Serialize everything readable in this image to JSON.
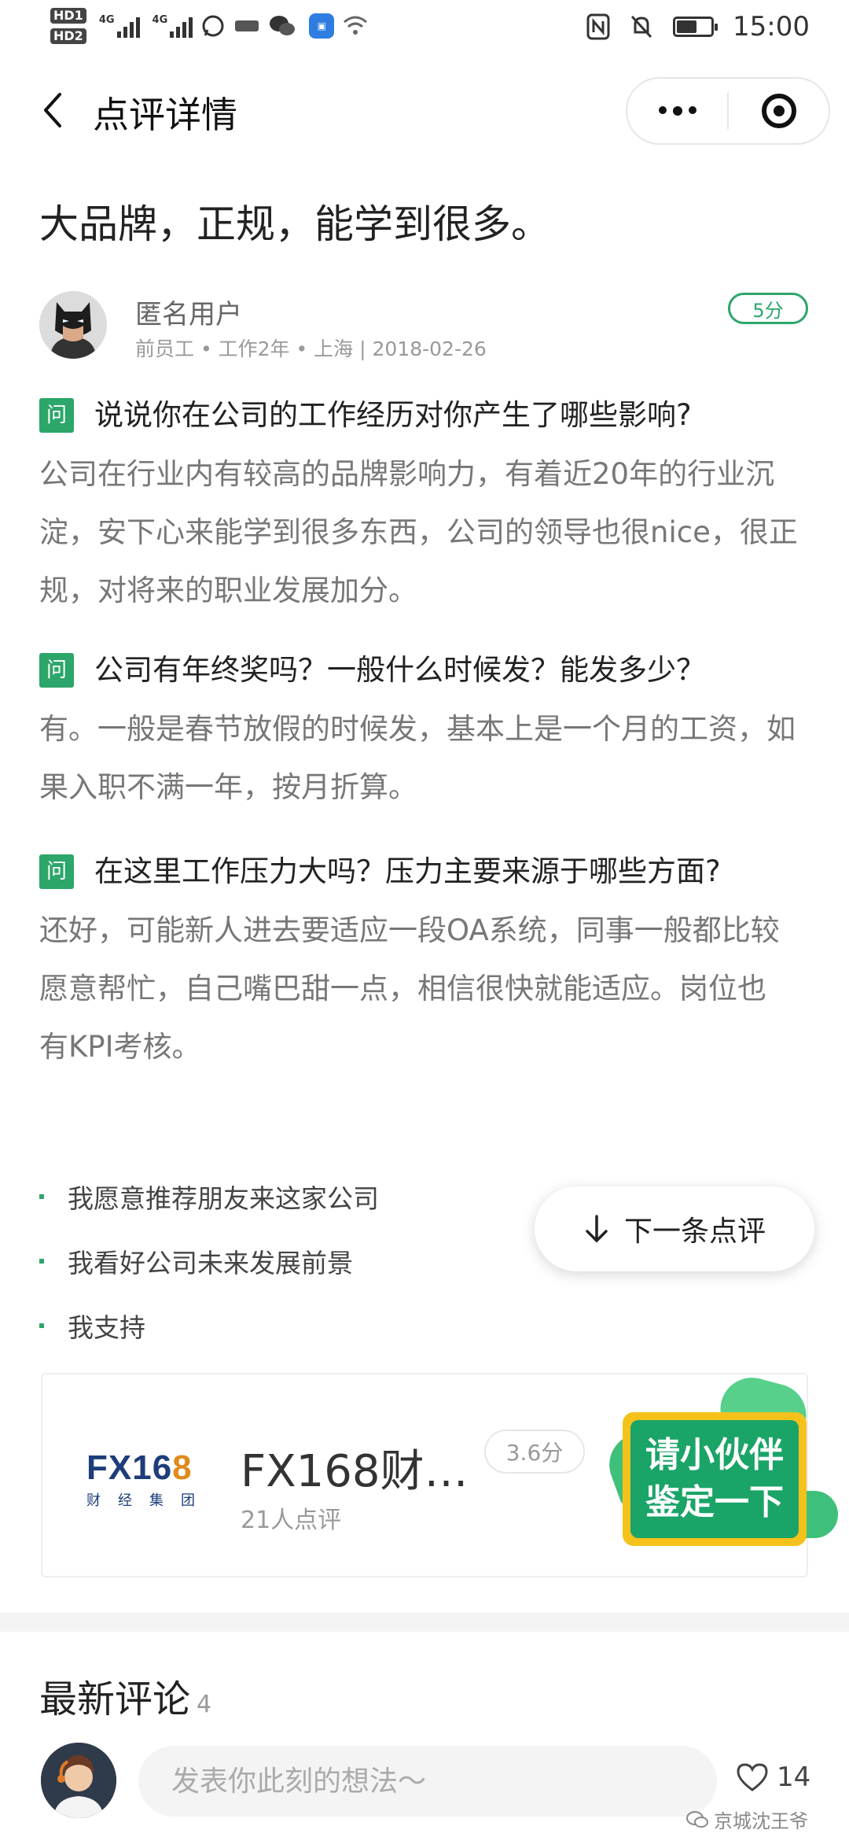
{
  "status_bar": {
    "hd1": "HD1",
    "hd2": "HD2",
    "net1": "4G",
    "net2": "4G",
    "time": "15:00",
    "battery_level": 0.6
  },
  "nav": {
    "title": "点评详情"
  },
  "review": {
    "title": "大品牌，正规，能学到很多。",
    "user_name": "匿名用户",
    "user_meta": "前员工 • 工作2年 • 上海 | 2018-02-26",
    "score": "5分",
    "qa": [
      {
        "tag": "问",
        "question": "说说你在公司的工作经历对你产生了哪些影响?",
        "answer": "公司在行业内有较高的品牌影响力，有着近20年的行业沉淀，安下心来能学到很多东西，公司的领导也很nice，很正规，对将来的职业发展加分。"
      },
      {
        "tag": "问",
        "question": "公司有年终奖吗？一般什么时候发？能发多少？",
        "answer": "有。一般是春节放假的时候发，基本上是一个月的工资，如果入职不满一年，按月折算。"
      },
      {
        "tag": "问",
        "question": "在这里工作压力大吗？压力主要来源于哪些方面?",
        "answer": "还好，可能新人进去要适应一段OA系统，同事一般都比较愿意帮忙，自己嘴巴甜一点，相信很快就能适应。岗位也有KPI考核。"
      }
    ],
    "bullets": [
      "我愿意推荐朋友来这家公司",
      "我看好公司未来发展前景",
      "我支持"
    ]
  },
  "next_button": {
    "label": "下一条点评"
  },
  "company": {
    "logo_text_a": "FX16",
    "logo_text_b": "8",
    "logo_sub": "财经集团",
    "name": "FX168财…",
    "review_count": "21人点评",
    "score": "3.6分"
  },
  "promo": {
    "line1": "请小伙伴",
    "line2": "鉴定一下"
  },
  "comments": {
    "title": "最新评论",
    "count": "4"
  },
  "bottom": {
    "input_placeholder": "发表你此刻的想法～",
    "likes": "14",
    "watermark": "京城沈王爷"
  },
  "colors": {
    "accent_green": "#2ca66a",
    "promo_yellow": "#f5c21b",
    "logo_blue": "#1e3d7a"
  }
}
